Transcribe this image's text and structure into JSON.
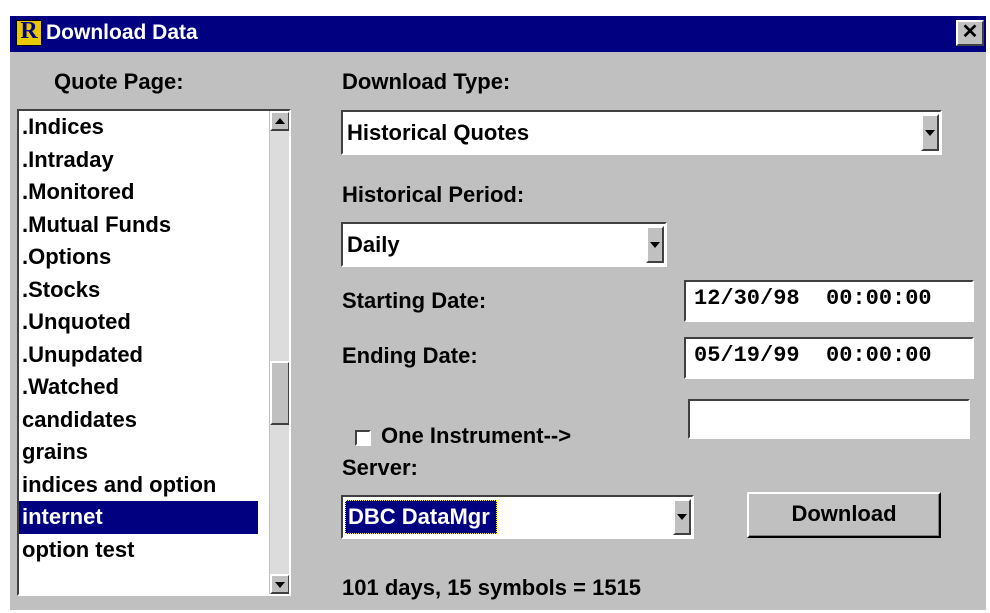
{
  "window": {
    "title": "Download Data",
    "app_icon_letter": "R",
    "close_glyph": "✕"
  },
  "quote_page": {
    "label": "Quote Page:",
    "items": [
      ".Indices",
      ".Intraday",
      ".Monitored",
      ".Mutual Funds",
      ".Options",
      ".Stocks",
      ".Unquoted",
      ".Unupdated",
      ".Watched",
      "candidates",
      "grains",
      "indices and option",
      "internet",
      "option test"
    ],
    "selected": "internet"
  },
  "download_type": {
    "label": "Download Type:",
    "value": "Historical Quotes"
  },
  "historical_period": {
    "label": "Historical Period:",
    "value": "Daily"
  },
  "starting_date": {
    "label": "Starting Date:",
    "value": "12/30/98  00:00:00"
  },
  "ending_date": {
    "label": "Ending Date:",
    "value": "05/19/99  00:00:00"
  },
  "one_instrument": {
    "label": "One Instrument-->",
    "checked": false,
    "value": ""
  },
  "server": {
    "label": "Server:",
    "value": "DBC DataMgr"
  },
  "download_button": "Download",
  "status": "101 days, 15 symbols = 1515",
  "colors": {
    "face": "#c0c0c0",
    "titlebar": "#000080",
    "selection": "#000080"
  }
}
